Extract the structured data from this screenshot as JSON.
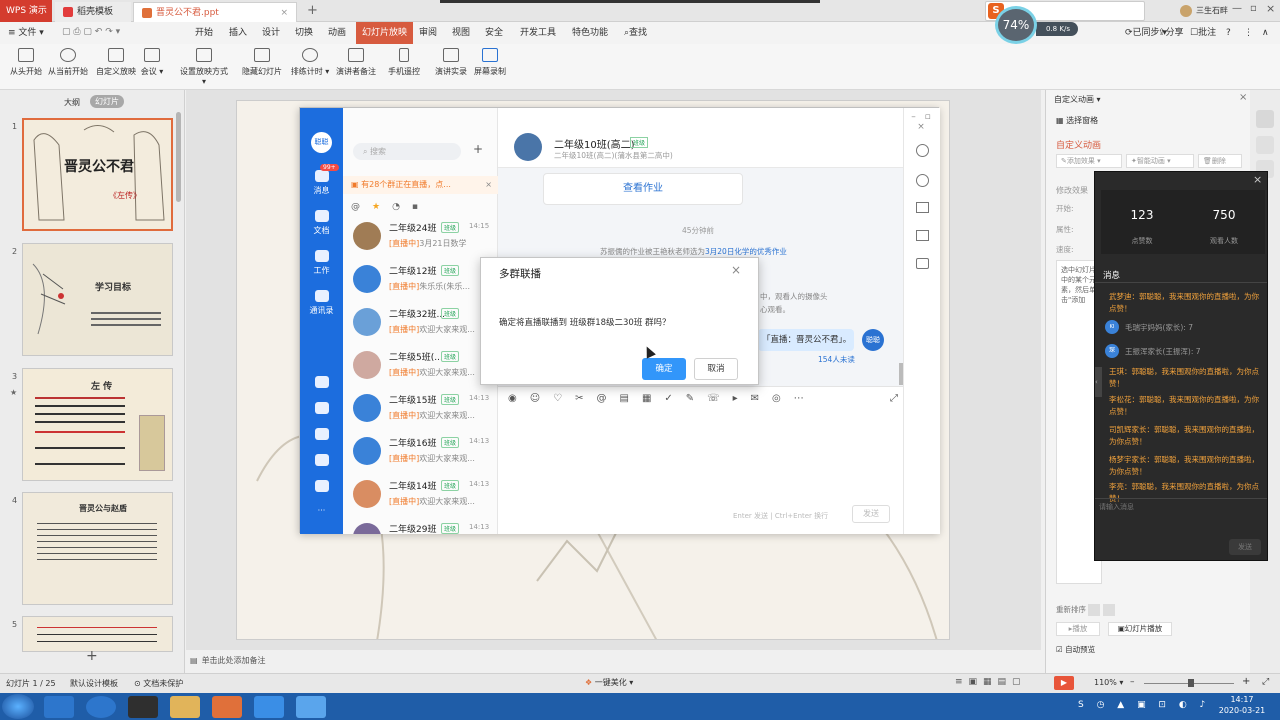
{
  "titlebar": {
    "app": "WPS 演示",
    "tabs": [
      "稻壳模板",
      "晋灵公不君.ppt"
    ],
    "user": "三生石畔",
    "speed_pct": "74%",
    "net_speed": "0.8",
    "net_unit": "K/s"
  },
  "menu": {
    "file": "文件",
    "items": [
      "开始",
      "插入",
      "设计",
      "切换",
      "动画",
      "幻灯片放映",
      "审阅",
      "视图",
      "安全",
      "开发工具",
      "特色功能"
    ],
    "search": "查找",
    "sync": "已同步",
    "share": "分享",
    "comment": "批注"
  },
  "toolbar": {
    "items": [
      "从头开始",
      "从当前开始",
      "自定义放映",
      "会议",
      "设置放映方式",
      "隐藏幻灯片",
      "排练计时",
      "演讲者备注",
      "手机遥控",
      "演讲实录",
      "屏幕录制"
    ]
  },
  "leftpanel": {
    "tab_outline": "大纲",
    "tab_slides": "幻灯片",
    "slides": [
      {
        "num": "1",
        "title": "晋灵公不君",
        "subtitle": "《左传》"
      },
      {
        "num": "2",
        "title": "学习目标",
        "subtitle": ""
      },
      {
        "num": "3",
        "title": "左  传",
        "subtitle": ""
      },
      {
        "num": "4",
        "title": "晋灵公与赵盾",
        "subtitle": ""
      },
      {
        "num": "5",
        "title": "",
        "subtitle": ""
      }
    ],
    "notes_hint": "单击此处添加备注"
  },
  "chat": {
    "search_placeholder": "搜索",
    "badge": "99+",
    "nav": [
      "消息",
      "文档",
      "工作",
      "通讯录"
    ],
    "live_notice": "有28个群正在直播，点...",
    "conversations": [
      {
        "name": "二年级24班",
        "tag": "班级",
        "time": "14:15",
        "prefix": "[直播中]",
        "msg": "3月21日数学"
      },
      {
        "name": "二年级12班",
        "tag": "班级",
        "time": "",
        "prefix": "[直播中]",
        "msg": "朱乐乐(朱乐..."
      },
      {
        "name": "二年级32班...",
        "tag": "班级",
        "time": "",
        "prefix": "[直播中]",
        "msg": "欢迎大家来观..."
      },
      {
        "name": "二年级5班(...",
        "tag": "班级",
        "time": "",
        "prefix": "[直播中]",
        "msg": "欢迎大家来观..."
      },
      {
        "name": "二年级15班",
        "tag": "班级",
        "time": "14:13",
        "prefix": "[直播中]",
        "msg": "欢迎大家来观..."
      },
      {
        "name": "二年级16班",
        "tag": "班级",
        "time": "14:13",
        "prefix": "[直播中]",
        "msg": "欢迎大家来观..."
      },
      {
        "name": "二年级14班",
        "tag": "班级",
        "time": "14:13",
        "prefix": "[直播中]",
        "msg": "欢迎大家来观..."
      },
      {
        "name": "二年级29班",
        "tag": "班级",
        "time": "14:13",
        "prefix": "",
        "msg": ""
      }
    ],
    "header_title": "二年级10班(高二)",
    "header_tag": "班级",
    "header_sub": "二年级10班(高二)(蒲水县第二高中)",
    "homework_btn": "查看作业",
    "time_divider": "45分钟前",
    "sys_msg": "苏振儒的作业被王艳秋老师选为",
    "sys_link": "3月20日化学的优秀作业",
    "bubble": "直播：晋灵公不君",
    "unread": "154人未读",
    "avatar_me": "聪聪",
    "input_hint": "Enter 发送 | Ctrl+Enter 换行",
    "send": "发送",
    "partial_text1": "中，观看人的摄像头",
    "partial_text2": "心观看。"
  },
  "dialog": {
    "title": "多群联播",
    "body": "确定将直播联播到 班级群18级二30班 群吗？",
    "confirm": "确定",
    "cancel": "取消"
  },
  "rightpanel": {
    "title": "自定义动画",
    "select_pane": "选择窗格",
    "section": "自定义动画",
    "add_effect": "添加效果",
    "smart_anim": "智能动画",
    "delete": "删除",
    "modify": "修改效果",
    "start": "开始:",
    "property": "属性:",
    "speed": "速度:",
    "hint": "选中幻灯片中的某个元素，然后单击\"添加",
    "reorder": "重新排序",
    "play": "播放",
    "slideshow": "幻灯片播放",
    "autopreview": "自动预览"
  },
  "live": {
    "likes": "123",
    "likes_label": "点赞数",
    "viewers": "750",
    "viewers_label": "观看人数",
    "messages_title": "消息",
    "messages": [
      {
        "type": "text",
        "text": "武梦迪：郭聪聪，我来围观你的直播啦，为你点赞！"
      },
      {
        "type": "like",
        "avatar": "KI",
        "text": "毛瑞宇妈妈(家长): 7"
      },
      {
        "type": "like",
        "avatar": "琛",
        "text": "王振浑家长(王振浑): 7"
      },
      {
        "type": "text",
        "text": "王琪：郭聪聪，我来围观你的直播啦，为你点赞！"
      },
      {
        "type": "text",
        "text": "李松花：郭聪聪，我来围观你的直播啦，为你点赞！"
      },
      {
        "type": "text",
        "text": "司凯辉家长：郭聪聪，我来围观你的直播啦，为你点赞！"
      },
      {
        "type": "text",
        "text": "杨梦宇家长：郭聪聪，我来围观你的直播啦，为你点赞！"
      },
      {
        "type": "text",
        "text": "李亮：郭聪聪，我来围观你的直播啦，为你点赞！"
      }
    ],
    "input_placeholder": "请输入消息",
    "send": "发送"
  },
  "statusbar": {
    "slide_pos": "幻灯片 1 / 25",
    "template": "默认设计模板",
    "protect": "文档未保护",
    "beautify": "一键美化",
    "zoom": "110%"
  },
  "taskbar": {
    "time": "14:17",
    "date": "2020-03-21"
  },
  "colors": {
    "accent": "#d75b3f",
    "chat_blue": "#1c6dde",
    "live_orange": "#f3a33c"
  }
}
